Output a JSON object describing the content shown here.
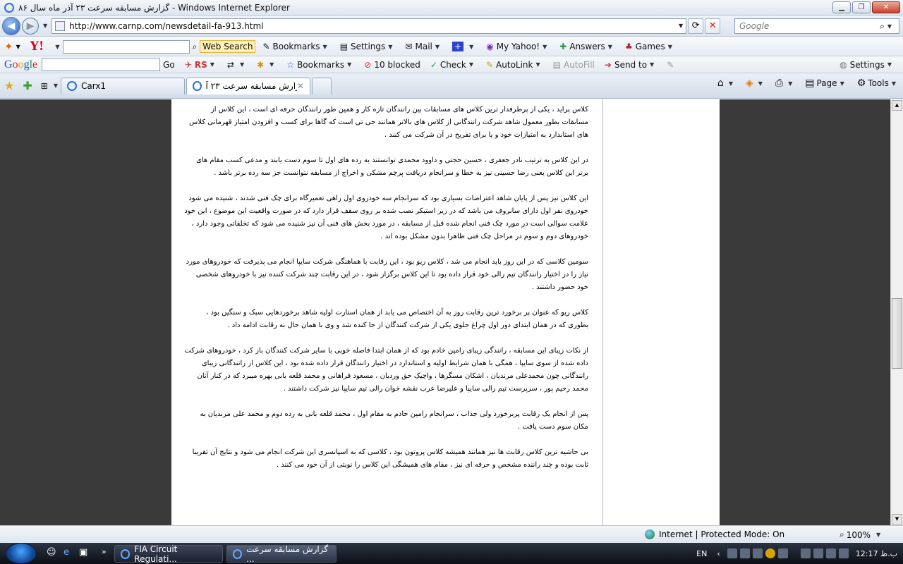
{
  "window": {
    "title": "گزارش مسابقه سرعت ۲۳ آذر ماه سال ۸۶ - Windows Internet Explorer"
  },
  "nav": {
    "url": "http://www.carnp.com/newsdetail-fa-913.html",
    "search_placeholder": "Google"
  },
  "yahoo_toolbar": {
    "web_search": "Web Search",
    "items": [
      "Bookmarks",
      "Settings",
      "Mail",
      "My Yahoo!",
      "Answers",
      "Games"
    ]
  },
  "google_toolbar": {
    "go": "Go",
    "rs": "RS",
    "bookmarks": "Bookmarks",
    "blocked": "10 blocked",
    "check": "Check",
    "autolink": "AutoLink",
    "autofill": "AutoFill",
    "sendto": "Send to",
    "settings": "Settings"
  },
  "tabs": [
    {
      "label": "Carx1"
    },
    {
      "label": "گزارش مسابقه سرعت ۲۳ آ..."
    }
  ],
  "commands": {
    "page": "Page",
    "tools": "Tools"
  },
  "article": {
    "paragraphs": [
      "کلاس پراید ، یکی از پرطرفدار ترین کلاس های مسابقات بین رانندگان تازه کار و همین طور رانندگان حرفه ای است ، این کلاس از مسابقات بطور معمول شاهد شرکت رانندگانی از کلاس های بالاتر همانند جی تی است که گاها برای کسب و افزودن امتیاز قهرمانی کلاس های استاندارد به امتیازات خود و یا برای تفریح در آن شرکت می کنند .",
      "در این کلاس به ترتیب نادر جعفری ، حسین حجتی و داوود محمدی توانستند به رده های اول تا سوم دست یابند و مدعی کسب مقام های برتر این کلاس یعنی رضا حسینی نیز به خطا و سرانجام دریافت پرچم مشکی و اخراج از مسابقه نتوانست جز سه رده برتر باشد .",
      "این کلاس نیز پس از پایان شاهد اعتراضات بسیاری بود که سرانجام سه خودروی اول راهی تعمیرگاه برای چک فنی شدند ، شنیده می شود خودروی نفر اول دارای سانروف می باشد که در زیر استیکر نصب شده بر روی سقف قرار دارد که در صورت واقعیت این موضوع ، این خود علامت سوالی است در مورد چک فنی انجام شده قبل از مسابقه ، در مورد بخش های فنی آن نیز شنیده می شود که تخلفاتی وجود دارد ، خودروهای دوم و سوم در مراحل چک فنی ظاهرا بدون مشکل بوده اند .",
      "سومین کلاسی که در این روز باید انجام می شد ، کلاس ریو بود ، این رقابت با هماهنگی شرکت سایپا انجام می پذیرفت که خودروهای مورد نیاز را در اختیار رانندگان تیم رالی خود قرار داده بود تا این کلاس برگزار شود ، در این رقابت چند شرکت کننده نیز با خودروهای شخصی خود حضور داشتند .",
      "کلاس ریو که عنوان پر برخورد ترین رقابت روز به آن اختصاص می یابد از همان استارت اولیه شاهد برخوردهایی سبک و سنگین بود ، بطوری که در همان ابتدای دور اول چراغ جلوی یکی از شرکت کنندگان از جا کنده شد و وی با همان حال به رقابت ادامه داد .",
      "از نکات زیبای این مسابقه ، رانندگی زیبای رامین خادم بود که از همان ابتدا فاصله خوبی با سایر شرکت کنندگان باز کرد ، خودروهای شرکت داده شده از سوی سایپا ، همگی با همان شرایط اولیه و استاندارد در اختیار رانندگان قرار داده شده بود ، این کلاس از رانندگانی زیبای رانندگانی چون محمدعلی مرندیان ، اشکان مسگرها ، واچیک حق وردیان ، مسعود فراهانی و محمد قلعه بانی بهره میبرد که در کنار آنان محمد رحیم پور ، سرپرست تیم رالی سایپا و علیرضا عرب نقشه خوان رالی تیم سایپا نیز شرکت داشتند .",
      "پس از انجام یک رقابت پربرخورد ولی جذاب ، سرانجام رامین خادم به مقام اول ، محمد قلعه بانی به رده دوم و محمد علی مرندیان به مکان سوم دست یافت .",
      "بی حاشیه ترین کلاس رقابت ها نیز همانند همیشه کلاس پروتون بود ، کلاسی که به اسپانسری این شرکت انجام می شود و نتایج آن تقریبا ثابت بوده و چند راننده مشخص و حرفه ای نیز ، مقام های همیشگی این کلاس را نوبتی از آن خود می کنند ."
    ]
  },
  "status": {
    "zone": "Internet | Protected Mode: On",
    "zoom": "100%"
  },
  "taskbar": {
    "tasks": [
      {
        "label": "FIA Circuit Regulati..."
      },
      {
        "label": "گزارش مسابقه سرعت ..."
      }
    ],
    "lang": "EN",
    "clock": "ب.ظ 12:17"
  }
}
